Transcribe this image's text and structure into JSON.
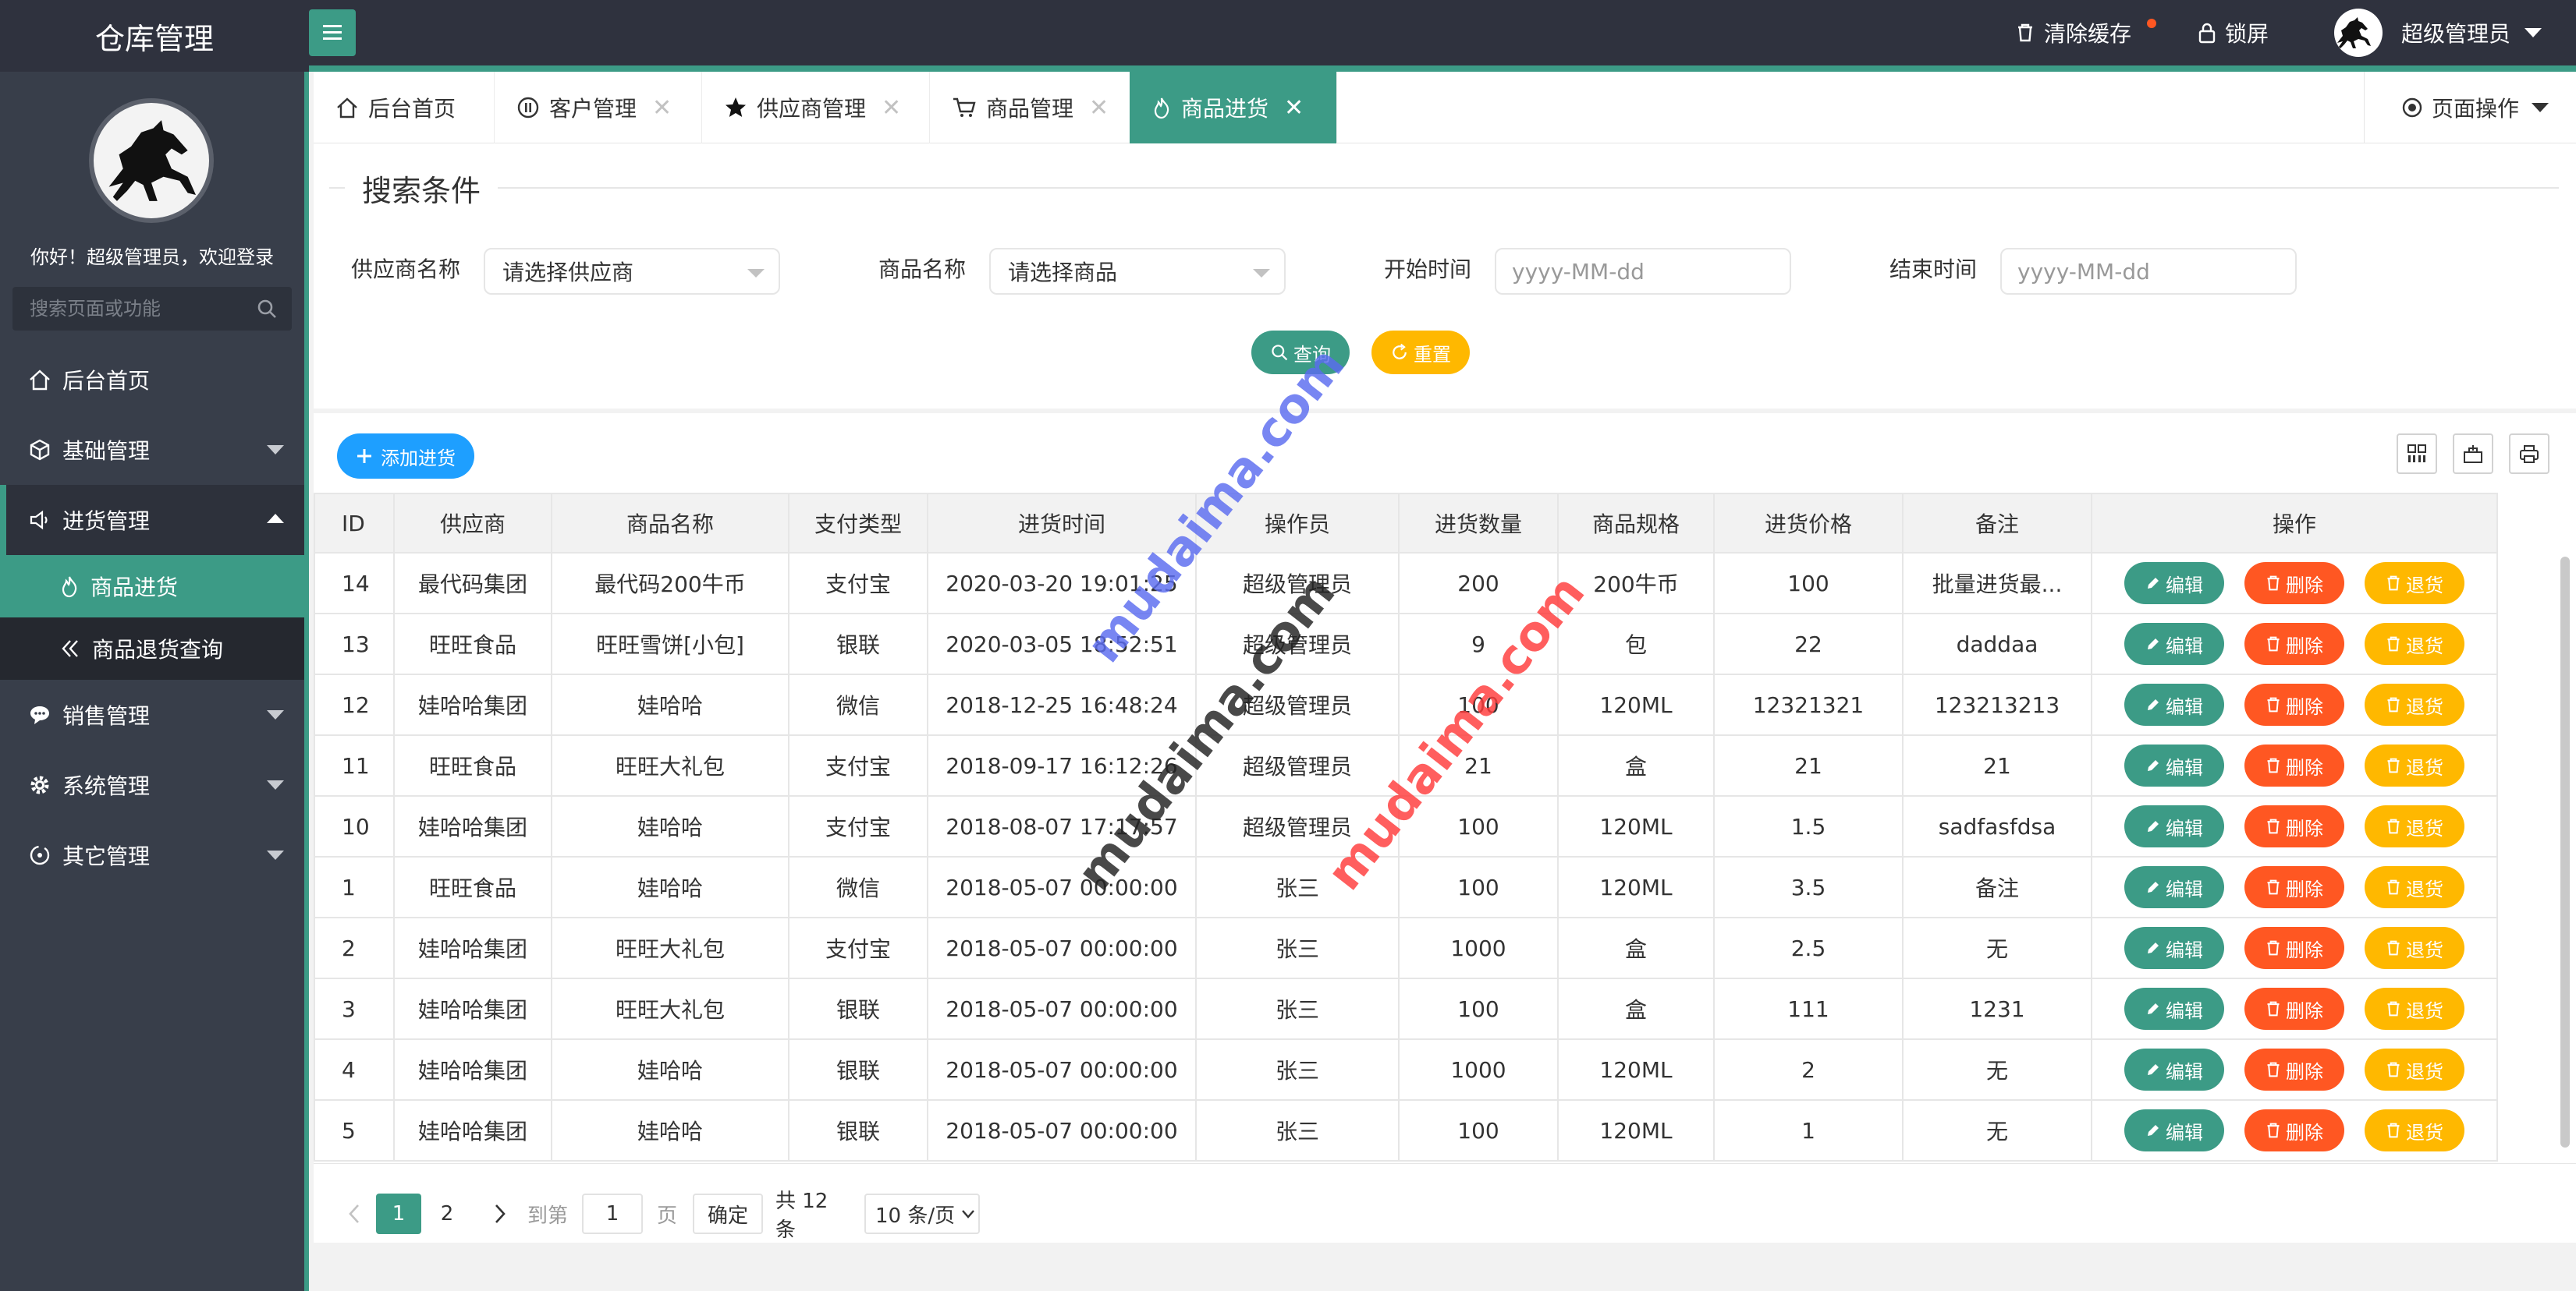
{
  "app": {
    "title": "仓库管理",
    "accent_color": "#3c9b86"
  },
  "header": {
    "clear_cache": "清除缓存",
    "lock_screen": "锁屏",
    "user_name": "超级管理员"
  },
  "sidebar": {
    "welcome": "你好！超级管理员，欢迎登录",
    "search_placeholder": "搜索页面或功能",
    "items": [
      {
        "label": "后台首页",
        "icon": "home-icon"
      },
      {
        "label": "基础管理",
        "icon": "cube-icon"
      },
      {
        "label": "进货管理",
        "icon": "volume-icon"
      },
      {
        "label": "销售管理",
        "icon": "chat-icon"
      },
      {
        "label": "系统管理",
        "icon": "gear-icon"
      },
      {
        "label": "其它管理",
        "icon": "circle-icon"
      }
    ],
    "sub_items": [
      {
        "label": "商品进货",
        "icon": "fire-icon"
      },
      {
        "label": "商品退货查询",
        "icon": "double-chevron-left-icon"
      }
    ]
  },
  "tabs": [
    {
      "label": "后台首页"
    },
    {
      "label": "客户管理"
    },
    {
      "label": "供应商管理"
    },
    {
      "label": "商品管理"
    },
    {
      "label": "商品进货"
    }
  ],
  "page_ops": "页面操作",
  "search": {
    "legend": "搜索条件",
    "supplier_label": "供应商名称",
    "supplier_value": "请选择供应商",
    "goods_label": "商品名称",
    "goods_value": "请选择商品",
    "start_label": "开始时间",
    "start_placeholder": "yyyy-MM-dd",
    "end_label": "结束时间",
    "end_placeholder": "yyyy-MM-dd",
    "query_btn": "查询",
    "reset_btn": "重置"
  },
  "toolbar": {
    "add_btn": "添加进货"
  },
  "table": {
    "columns": [
      "ID",
      "供应商",
      "商品名称",
      "支付类型",
      "进货时间",
      "操作员",
      "进货数量",
      "商品规格",
      "进货价格",
      "备注",
      "操作"
    ],
    "row_buttons": {
      "edit": "编辑",
      "delete": "删除",
      "return": "退货"
    },
    "rows": [
      [
        "14",
        "最代码集团",
        "最代码200牛币",
        "支付宝",
        "2020-03-20 19:01:25",
        "超级管理员",
        "200",
        "200牛币",
        "100",
        "批量进货最..."
      ],
      [
        "13",
        "旺旺食品",
        "旺旺雪饼[小包]",
        "银联",
        "2020-03-05 18:52:51",
        "超级管理员",
        "9",
        "包",
        "22",
        "daddaa"
      ],
      [
        "12",
        "娃哈哈集团",
        "娃哈哈",
        "微信",
        "2018-12-25 16:48:24",
        "超级管理员",
        "100",
        "120ML",
        "12321321",
        "123213213"
      ],
      [
        "11",
        "旺旺食品",
        "旺旺大礼包",
        "支付宝",
        "2018-09-17 16:12:26",
        "超级管理员",
        "21",
        "盒",
        "21",
        "21"
      ],
      [
        "10",
        "娃哈哈集团",
        "娃哈哈",
        "支付宝",
        "2018-08-07 17:17:57",
        "超级管理员",
        "100",
        "120ML",
        "1.5",
        "sadfasfdsa"
      ],
      [
        "1",
        "旺旺食品",
        "娃哈哈",
        "微信",
        "2018-05-07 00:00:00",
        "张三",
        "100",
        "120ML",
        "3.5",
        "备注"
      ],
      [
        "2",
        "娃哈哈集团",
        "旺旺大礼包",
        "支付宝",
        "2018-05-07 00:00:00",
        "张三",
        "1000",
        "盒",
        "2.5",
        "无"
      ],
      [
        "3",
        "娃哈哈集团",
        "旺旺大礼包",
        "银联",
        "2018-05-07 00:00:00",
        "张三",
        "100",
        "盒",
        "111",
        "1231"
      ],
      [
        "4",
        "娃哈哈集团",
        "娃哈哈",
        "银联",
        "2018-05-07 00:00:00",
        "张三",
        "1000",
        "120ML",
        "2",
        "无"
      ],
      [
        "5",
        "娃哈哈集团",
        "娃哈哈",
        "银联",
        "2018-05-07 00:00:00",
        "张三",
        "100",
        "120ML",
        "1",
        "无"
      ]
    ]
  },
  "pagination": {
    "current": "1",
    "page2": "2",
    "goto_label": "到第",
    "goto_value": "1",
    "page_unit": "页",
    "confirm": "确定",
    "total": "共 12 条",
    "page_size": "10 条/页"
  },
  "watermarks": [
    "mudaima.com",
    "mudaima.com",
    "mudaima.com"
  ]
}
